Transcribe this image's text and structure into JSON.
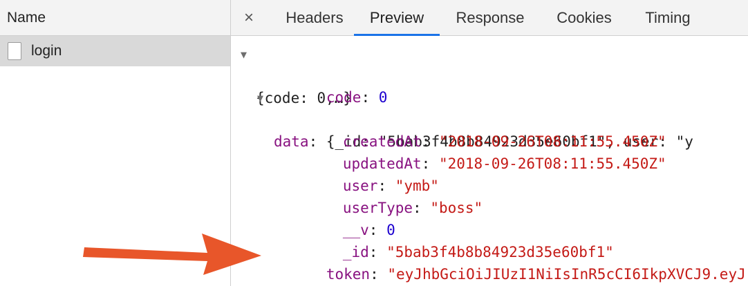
{
  "left": {
    "header": "Name",
    "request_name": "login"
  },
  "tabs": {
    "close_glyph": "×",
    "items": [
      "Headers",
      "Preview",
      "Response",
      "Cookies",
      "Timing"
    ],
    "active": "Preview"
  },
  "preview": {
    "root_summary": "{code: 0,…}",
    "code_key": "code",
    "code_value": "0",
    "data_key": "data",
    "data_summary_prefix": "{_id: ",
    "data_summary_id": "\"5bab3f4b8b84923d35e60bf1\"",
    "data_summary_user_key": ", user: \"y",
    "fields": [
      {
        "key": "createdAt",
        "value": "\"2018-09-26T08:11:55.450Z\"",
        "type": "string"
      },
      {
        "key": "updatedAt",
        "value": "\"2018-09-26T08:11:55.450Z\"",
        "type": "string"
      },
      {
        "key": "user",
        "value": "\"ymb\"",
        "type": "string"
      },
      {
        "key": "userType",
        "value": "\"boss\"",
        "type": "string"
      },
      {
        "key": "__v",
        "value": "0",
        "type": "number"
      },
      {
        "key": "_id",
        "value": "\"5bab3f4b8b84923d35e60bf1\"",
        "type": "string"
      }
    ],
    "token_key": "token",
    "token_value": "\"eyJhbGciOiJIUzI1NiIsInR5cCI6IkpXVCJ9.eyJ"
  },
  "colors": {
    "key": "#881280",
    "string": "#c41a16",
    "number": "#1c00cf",
    "arrow": "#e8562a",
    "active_tab_underline": "#1a73e8"
  }
}
